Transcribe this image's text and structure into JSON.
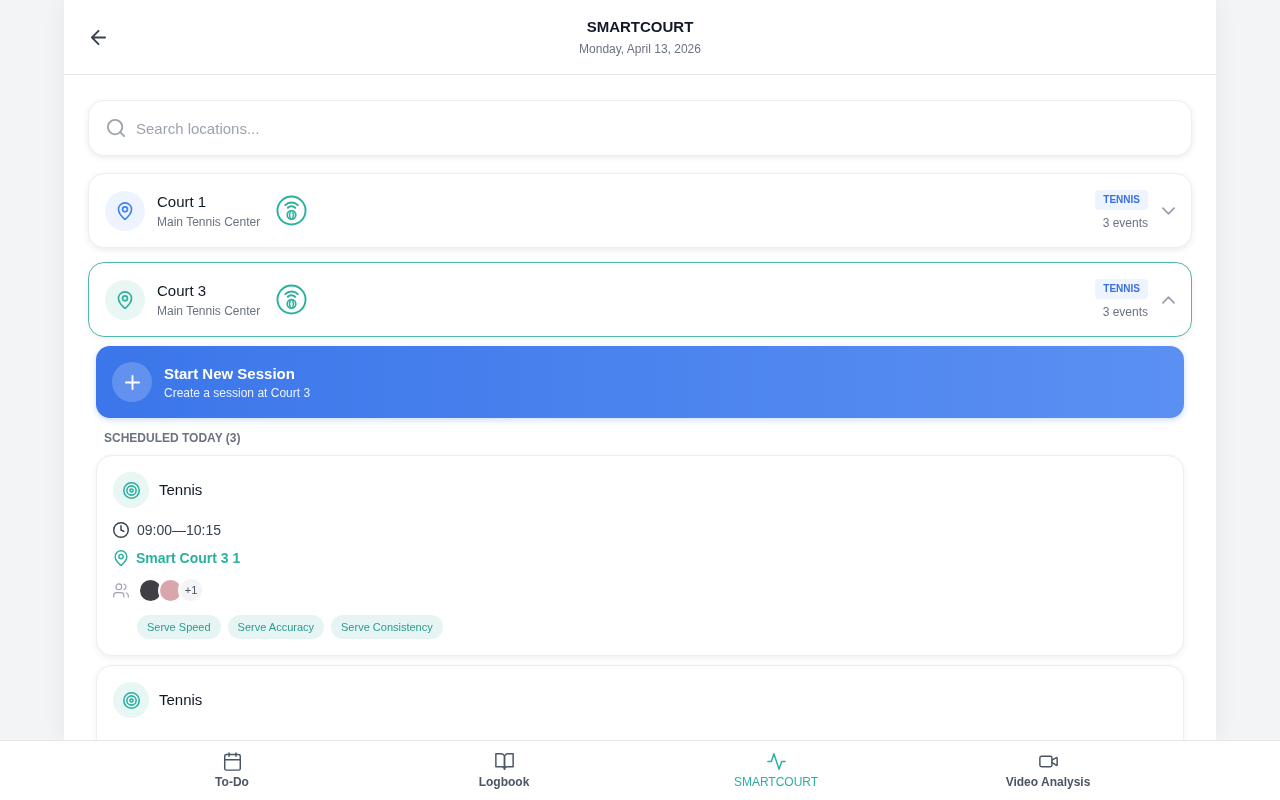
{
  "header": {
    "title": "SMARTCOURT",
    "date": "Monday, April 13, 2026"
  },
  "search": {
    "placeholder": "Search locations..."
  },
  "locations": [
    {
      "name": "Court 1",
      "venue": "Main Tennis Center",
      "sport": "TENNIS",
      "events": "3 events",
      "expanded": false
    },
    {
      "name": "Court 3",
      "venue": "Main Tennis Center",
      "sport": "TENNIS",
      "events": "3 events",
      "expanded": true,
      "new_session": {
        "title": "Start New Session",
        "subtitle": "Create a session at Court 3"
      },
      "schedule": {
        "heading": "SCHEDULED TODAY (3)",
        "sessions": [
          {
            "sport": "Tennis",
            "time": "09:00—10:15",
            "court": "Smart Court 3 1",
            "more_participants": "+1",
            "tags": [
              "Serve Speed",
              "Serve Accuracy",
              "Serve Consistency"
            ]
          },
          {
            "sport": "Tennis"
          }
        ]
      }
    }
  ],
  "nav": [
    {
      "kind": "calendar",
      "label": "To-Do",
      "selected": false
    },
    {
      "kind": "book",
      "label": "Logbook",
      "selected": false
    },
    {
      "kind": "pulse",
      "label": "SMARTCOURT",
      "selected": true
    },
    {
      "kind": "video",
      "label": "Video Analysis",
      "selected": false
    }
  ]
}
